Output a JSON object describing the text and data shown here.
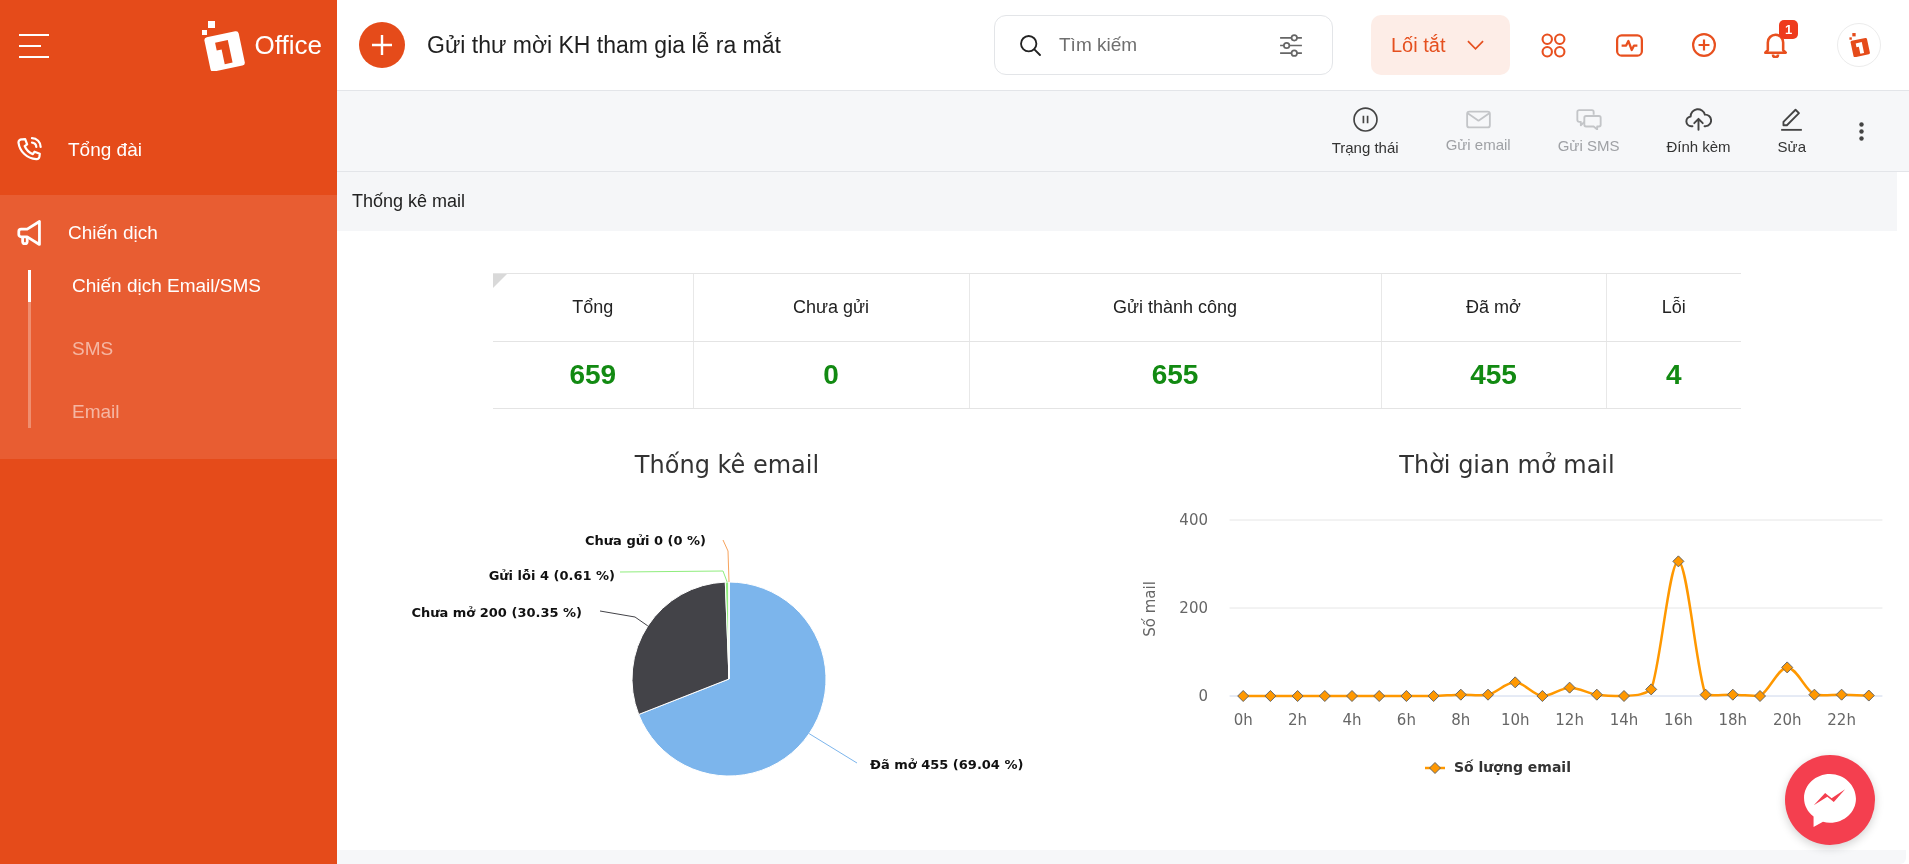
{
  "sidebar": {
    "brand": "Office",
    "items": [
      {
        "label": "Tổng đài",
        "expanded": false
      },
      {
        "label": "Chiến dịch",
        "expanded": true,
        "children": [
          {
            "label": "Chiến dịch Email/SMS",
            "selected": true
          },
          {
            "label": "SMS",
            "selected": false
          },
          {
            "label": "Email",
            "selected": false
          }
        ]
      }
    ]
  },
  "header": {
    "title": "Gửi thư mời KH tham gia lễ ra mắt",
    "search": {
      "placeholder": "Tìm kiếm"
    },
    "shortcut_button": "Lối tắt",
    "notification_badge": "1"
  },
  "toolbar": [
    {
      "label": "Trạng thái",
      "disabled": false
    },
    {
      "label": "Gửi email",
      "disabled": true
    },
    {
      "label": "Gửi SMS",
      "disabled": true
    },
    {
      "label": "Đính kèm",
      "disabled": false
    },
    {
      "label": "Sửa",
      "disabled": false
    }
  ],
  "mail_stats": {
    "title": "Thống kê mail",
    "table": {
      "columns": [
        "Tổng",
        "Chưa gửi",
        "Gửi thành công",
        "Đã mở",
        "Lỗi"
      ],
      "values": [
        "659",
        "0",
        "655",
        "455",
        "4"
      ]
    },
    "email_chart": {
      "chart_data": {
        "type": "pie",
        "title": "Thống kê email",
        "categories": [
          "Đã mở 455 (69.04 %)",
          "Chưa mở 200 (30.35 %)",
          "Gửi lỗi 4 (0.61 %)",
          "Chưa gửi 0 (0 %)"
        ],
        "values": [
          455,
          200,
          4,
          0
        ],
        "colors": [
          "#7cb5ec",
          "#434348",
          "#90ed7d",
          "#f7a35c"
        ]
      }
    },
    "open_time_chart": {
      "chart_data": {
        "type": "line",
        "title": "Thời gian mở mail",
        "ylabel": "Số mail",
        "x": [
          0,
          1,
          2,
          3,
          4,
          5,
          6,
          7,
          8,
          9,
          10,
          11,
          12,
          13,
          14,
          15,
          16,
          17,
          18,
          19,
          20,
          21,
          22,
          23
        ],
        "series": [
          {
            "name": "Số lượng email",
            "color": "#ff9800",
            "marker": true,
            "values": [
              0,
              0,
              0,
              0,
              0,
              0,
              0,
              0,
              3,
              3,
              31,
              0,
              19,
              3,
              0,
              15,
              306,
              3,
              3,
              0,
              65,
              3,
              3,
              1
            ]
          }
        ],
        "xlim": [
          -0.5,
          23.5
        ],
        "ylim": [
          0,
          400
        ],
        "yticks": [
          0,
          200,
          400
        ],
        "xticks": [
          {
            "value": 0,
            "label": "0h"
          },
          {
            "value": 2,
            "label": "2h"
          },
          {
            "value": 4,
            "label": "4h"
          },
          {
            "value": 6,
            "label": "6h"
          },
          {
            "value": 8,
            "label": "8h"
          },
          {
            "value": 10,
            "label": "10h"
          },
          {
            "value": 12,
            "label": "12h"
          },
          {
            "value": 14,
            "label": "14h"
          },
          {
            "value": 16,
            "label": "16h"
          },
          {
            "value": 18,
            "label": "18h"
          },
          {
            "value": 20,
            "label": "20h"
          },
          {
            "value": 22,
            "label": "22h"
          }
        ]
      }
    }
  }
}
